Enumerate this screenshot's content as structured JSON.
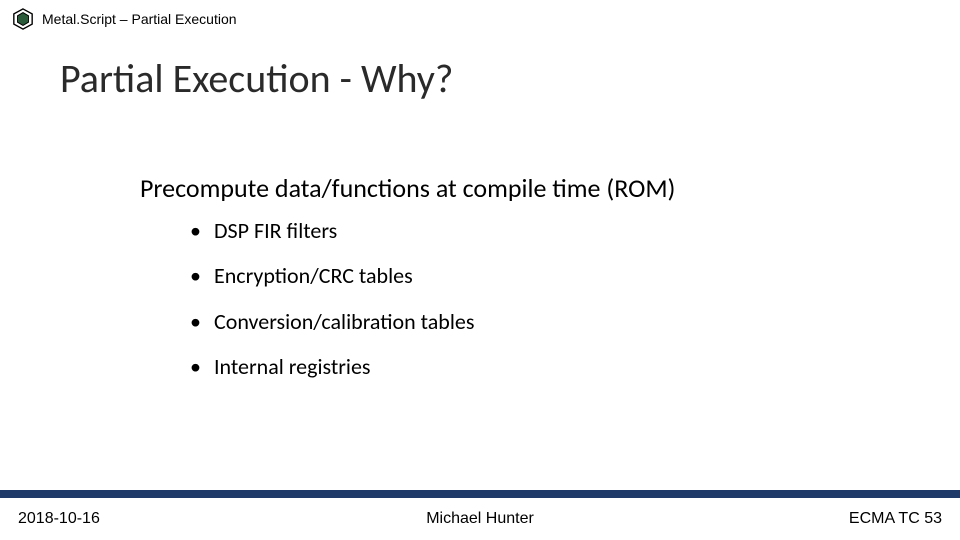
{
  "header": {
    "icon_name": "hexagon-logo",
    "text": "Metal.Script – Partial Execution"
  },
  "title": "Partial Execution - Why?",
  "subheading": "Precompute data/functions at compile time (ROM)",
  "bullets": [
    "DSP FIR filters",
    "Encryption/CRC tables",
    "Conversion/calibration tables",
    "Internal registries"
  ],
  "footer": {
    "left": "2018-10-16",
    "center": "Michael Hunter",
    "right": "ECMA TC 53"
  },
  "colors": {
    "footer_bar": "#1f3a68"
  }
}
